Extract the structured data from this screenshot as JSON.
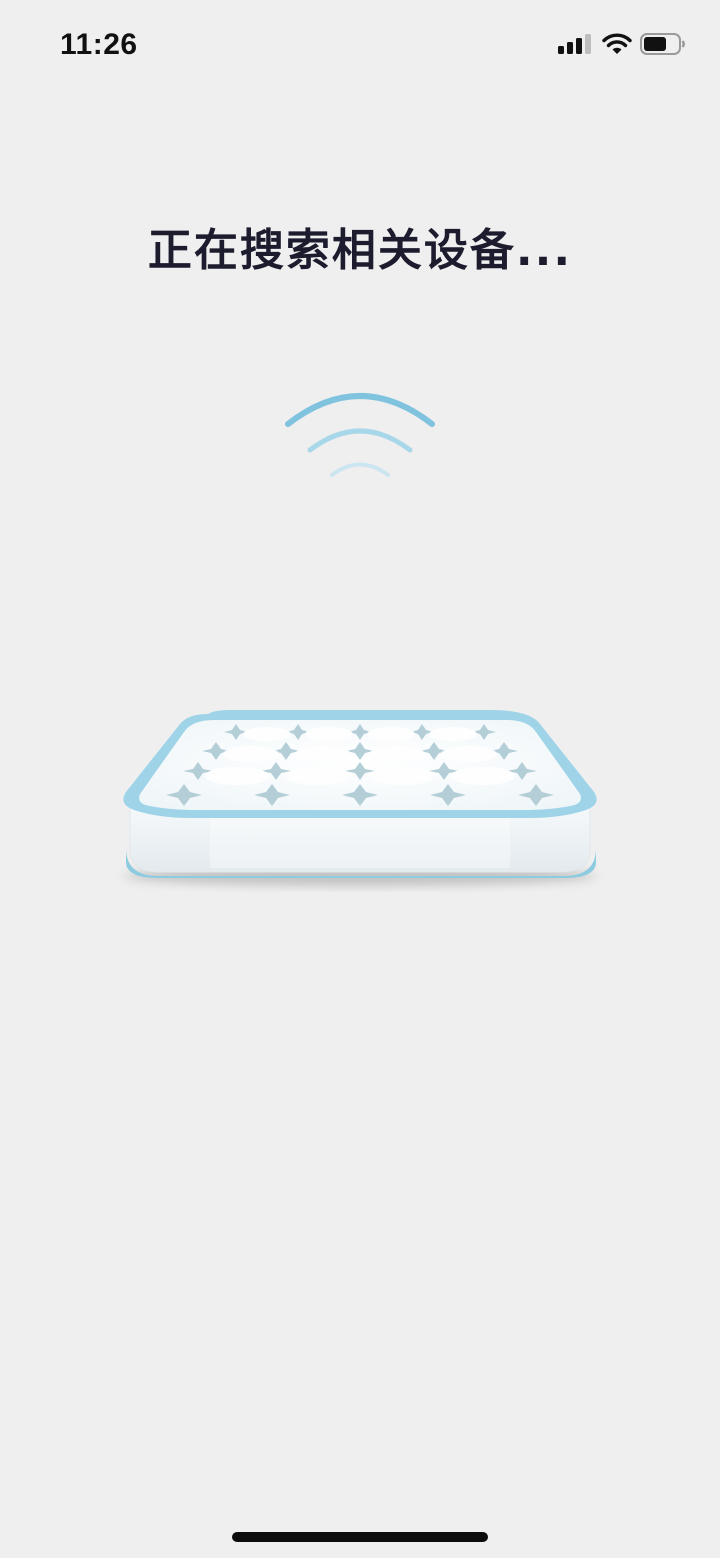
{
  "status_bar": {
    "time": "11:26",
    "icons": [
      "cellular-signal-icon",
      "wifi-icon",
      "battery-icon"
    ],
    "battery_level": 0.55
  },
  "main": {
    "title": "正在搜索相关设备..."
  },
  "graphics": {
    "signal": "wireless-signal-icon",
    "device": "smart-mattress-device-icon",
    "accent_color": "#8ccbe0"
  }
}
